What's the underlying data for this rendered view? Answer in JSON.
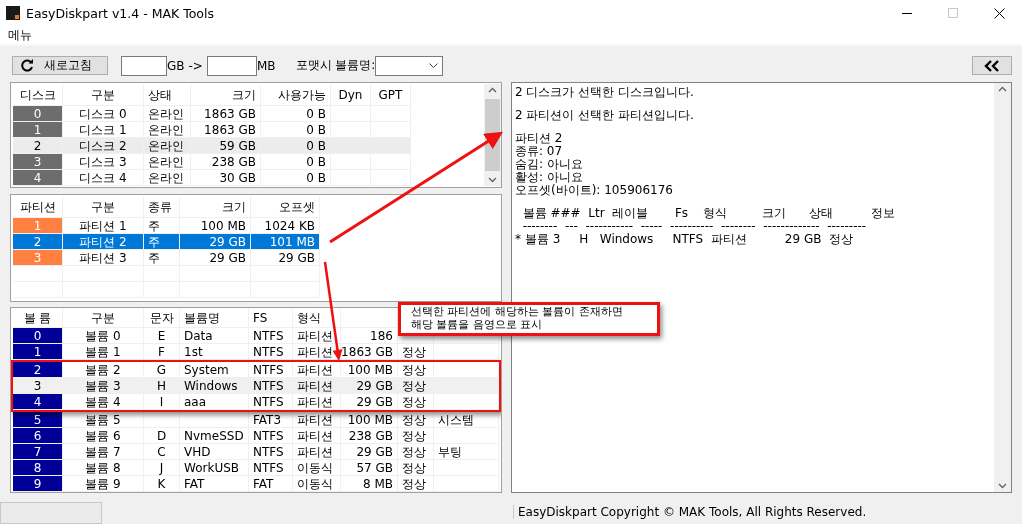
{
  "window": {
    "title": "EasyDiskpart v1.4 - MAK Tools"
  },
  "menu": [
    "메뉴"
  ],
  "toolbar": {
    "refresh_button": "새로고침",
    "from_unit": "GB",
    "arrow": "->",
    "to_unit": "MB",
    "format_label": "포맷시 볼륨명:"
  },
  "tables": [
    {
      "kind": "disk",
      "columns": [
        "디스크",
        "구분",
        "상태",
        "크기",
        "사용가능",
        "Dyn",
        "GPT"
      ],
      "rows": [
        {
          "cells": [
            "0",
            "디스크 0",
            "온라인",
            "1863 GB",
            "0 B",
            null,
            null
          ],
          "selected": false
        },
        {
          "cells": [
            "1",
            "디스크 1",
            "온라인",
            "1863 GB",
            "0 B",
            null,
            null
          ],
          "selected": false
        },
        {
          "cells": [
            "2",
            "디스크 2",
            "온라인",
            "59 GB",
            "0 B",
            null,
            null
          ],
          "selected": true
        },
        {
          "cells": [
            "3",
            "디스크 3",
            "온라인",
            "238 GB",
            "0 B",
            null,
            null
          ],
          "selected": false
        },
        {
          "cells": [
            "4",
            "디스크 4",
            "온라인",
            "30 GB",
            "0 B",
            null,
            null
          ],
          "selected": false
        }
      ]
    },
    {
      "kind": "partition",
      "columns": [
        "파티션",
        "구분",
        "종류",
        "크기",
        "오프셋"
      ],
      "rows": [
        {
          "cells": [
            "1",
            "파티션 1",
            "주",
            "100 MB",
            "1024 KB"
          ],
          "selected": false
        },
        {
          "cells": [
            "2",
            "파티션 2",
            "주",
            "29 GB",
            "101 MB"
          ],
          "selected": true
        },
        {
          "cells": [
            "3",
            "파티션 3",
            "주",
            "29 GB",
            "29 GB"
          ],
          "selected": false
        }
      ]
    },
    {
      "kind": "volume",
      "columns": [
        "볼  륨",
        "구분",
        "문자",
        "볼륨명",
        "FS",
        "형식",
        null,
        null,
        null
      ],
      "rows": [
        {
          "cells": [
            "0",
            "볼륨 0",
            "E",
            "Data",
            "NTFS",
            "파티션",
            "186",
            null,
            null
          ],
          "selected": false
        },
        {
          "cells": [
            "1",
            "볼륨 1",
            "F",
            "1st",
            "NTFS",
            "파티션",
            "1863 GB",
            "정상",
            null
          ],
          "selected": false
        },
        {
          "cells": [
            "2",
            "볼륨 2",
            "G",
            "System",
            "NTFS",
            "파티션",
            "100 MB",
            "정상",
            null
          ],
          "selected": false
        },
        {
          "cells": [
            "3",
            "볼륨 3",
            "H",
            "Windows",
            "NTFS",
            "파티션",
            "29 GB",
            "정상",
            null
          ],
          "selected": true
        },
        {
          "cells": [
            "4",
            "볼륨 4",
            "I",
            "aaa",
            "NTFS",
            "파티션",
            "29 GB",
            "정상",
            null
          ],
          "selected": false
        },
        {
          "cells": [
            "5",
            "볼륨 5",
            null,
            null,
            "FAT3",
            "파티션",
            "100 MB",
            "정상",
            "시스템"
          ],
          "selected": false
        },
        {
          "cells": [
            "6",
            "볼륨 6",
            "D",
            "NvmeSSD",
            "NTFS",
            "파티션",
            "238 GB",
            "정상",
            null
          ],
          "selected": false
        },
        {
          "cells": [
            "7",
            "볼륨 7",
            "C",
            "VHD",
            "NTFS",
            "파티션",
            "29 GB",
            "정상",
            "부팅"
          ],
          "selected": false
        },
        {
          "cells": [
            "8",
            "볼륨 8",
            "J",
            "WorkUSB",
            "NTFS",
            "이동식",
            "57 GB",
            "정상",
            null
          ],
          "selected": false
        },
        {
          "cells": [
            "9",
            "볼륨 9",
            "K",
            "FAT",
            "FAT",
            "이동식",
            "8 MB",
            "정상",
            null
          ],
          "selected": false
        }
      ]
    }
  ],
  "output": [
    [
      "2 디스크가 선택한 디스크입니다."
    ],
    [
      "2 파티션이 선택한 파티션입니다."
    ],
    [
      "파티션 2",
      "종류: 07",
      "숨김: 아니요",
      "활성: 아니요",
      "오프셋(바이트): 105906176"
    ],
    [
      "  볼륨 ###  Ltr  레이블       Fs    형식         크기      상태          정보",
      "  --------  ---  -----------  -----  ----------  --------  -------------  ---------",
      "* 볼륨 3     H   Windows     NTFS  파티션          29 GB  정상"
    ]
  ],
  "callout": [
    "선택한 파티션에 해당하는 볼륨이 존재하면",
    "해당 볼륨을 음영으로 표시"
  ],
  "status_bar": "EasyDiskpart Copyright © MAK Tools, All Rights Reserved."
}
